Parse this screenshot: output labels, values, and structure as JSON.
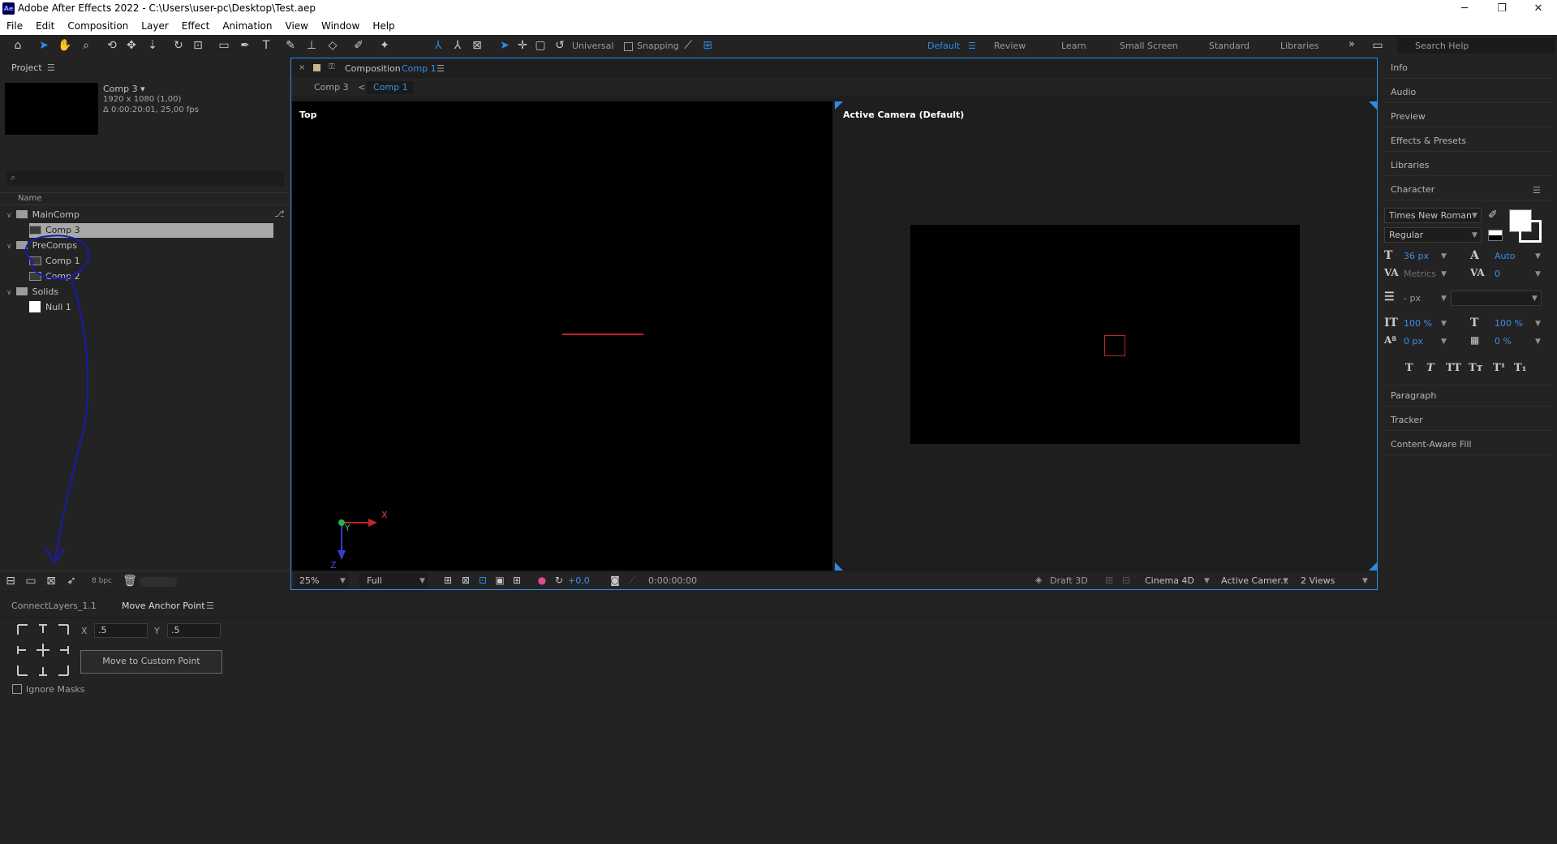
{
  "window": {
    "logo": "Ae",
    "title": "Adobe After Effects 2022 - C:\\Users\\user-pc\\Desktop\\Test.aep",
    "minimize": "─",
    "maximize": "❐",
    "close": "✕"
  },
  "menu": [
    "File",
    "Edit",
    "Composition",
    "Layer",
    "Effect",
    "Animation",
    "View",
    "Window",
    "Help"
  ],
  "toolbar": {
    "axis_mode": "Universal",
    "snapping": "Snapping",
    "workspaces": [
      "Default",
      "Review",
      "Learn",
      "Small Screen",
      "Standard",
      "Libraries"
    ],
    "active_workspace": "Default",
    "more": "»",
    "search_placeholder": "Search Help"
  },
  "project": {
    "title": "Project",
    "selected_name": "Comp 3 ▾",
    "selected_size": "1920 x 1080 (1,00)",
    "selected_duration": "Δ 0:00:20:01, 25,00 fps",
    "search_placeholder": "",
    "col_name": "Name",
    "tree": [
      {
        "label": "MainComp",
        "type": "folder"
      },
      {
        "label": "Comp 3",
        "type": "comp"
      },
      {
        "label": "PreComps",
        "type": "folder"
      },
      {
        "label": "Comp 1",
        "type": "comp"
      },
      {
        "label": "Comp 2",
        "type": "comp"
      },
      {
        "label": "Solids",
        "type": "folder"
      },
      {
        "label": "Null 1",
        "type": "null"
      }
    ],
    "bpc": "8 bpc"
  },
  "composition": {
    "tab_prefix": "Composition",
    "tab_name": "Comp 1",
    "breadcrumb_parent": "Comp 3",
    "breadcrumb_sep": "<",
    "breadcrumb_current": "Comp 1",
    "left_view_label": "Top",
    "right_view_label": "Active Camera (Default)",
    "axis_x": "X",
    "axis_y": "Y",
    "axis_z": "Z",
    "zoom": "25%",
    "resolution": "Full",
    "exposure": "+0,0",
    "timecode": "0:00:00:00",
    "draft3d": "Draft 3D",
    "renderer": "Cinema 4D",
    "camera": "Active Camer...",
    "views": "2 Views"
  },
  "right_panel": {
    "items_top": [
      "Info",
      "Audio",
      "Preview",
      "Effects & Presets",
      "Libraries"
    ],
    "character_title": "Character",
    "font": "Times New Roman",
    "style": "Regular",
    "font_size": "36 px",
    "leading": "Auto",
    "kerning": "Metrics",
    "tracking": "0",
    "stroke_width": "- px",
    "vscale": "100 %",
    "hscale": "100 %",
    "baseline": "0 px",
    "tsume": "0 %",
    "style_buttons": [
      "T",
      "T",
      "TT",
      "Tт",
      "T¹",
      "T₁"
    ],
    "items_bottom": [
      "Paragraph",
      "Tracker",
      "Content-Aware Fill"
    ]
  },
  "bottom_panel": {
    "tabs": [
      "ConnectLayers_1.1",
      "Move Anchor Point"
    ],
    "active_tab": "Move Anchor Point",
    "x_label": "X",
    "x_value": ".5",
    "y_label": "Y",
    "y_value": ".5",
    "button": "Move to Custom Point",
    "ignore_masks": "Ignore Masks"
  },
  "colors": {
    "accent": "#2d8ceb",
    "annotation": "#1a1ab0",
    "camera_red": "#c0262c"
  }
}
